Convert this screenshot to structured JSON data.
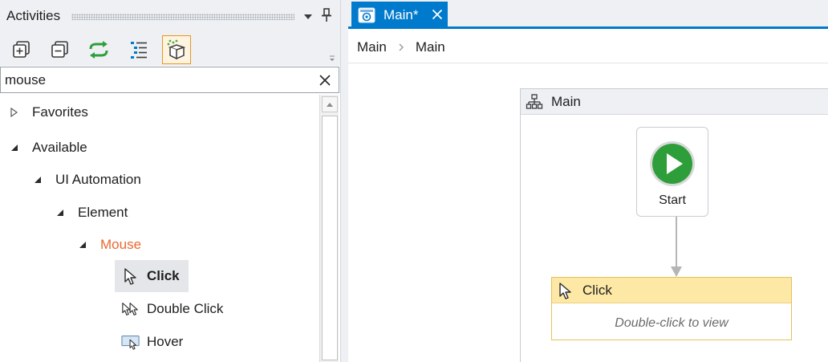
{
  "activities_panel": {
    "title": "Activities",
    "toolbar": {
      "expand_all_icon": "expand-all-icon",
      "collapse_all_icon": "collapse-all-icon",
      "refresh_icon": "refresh-icon",
      "list_view_icon": "list-view-icon",
      "package_icon": "package-icon"
    },
    "search": {
      "value": "mouse",
      "placeholder": ""
    },
    "tree": {
      "favorites": "Favorites",
      "available": "Available",
      "ui_automation": "UI Automation",
      "element": "Element",
      "mouse": "Mouse",
      "activities": [
        {
          "label": "Click",
          "icon": "cursor-icon",
          "selected": true
        },
        {
          "label": "Double Click",
          "icon": "double-cursor-icon",
          "selected": false
        },
        {
          "label": "Hover",
          "icon": "hover-icon",
          "selected": false
        }
      ]
    }
  },
  "designer": {
    "tab": {
      "label": "Main*",
      "icon": "workflow-icon"
    },
    "breadcrumb": [
      "Main",
      "Main"
    ],
    "flowchart": {
      "title": "Main",
      "start_label": "Start",
      "activity": {
        "title": "Click",
        "hint": "Double-click to view"
      }
    }
  },
  "colors": {
    "accent": "#007acc",
    "selected_tree_item": "#e8692f",
    "start_green": "#2e9e3a",
    "activity_header": "#fde8a6"
  }
}
